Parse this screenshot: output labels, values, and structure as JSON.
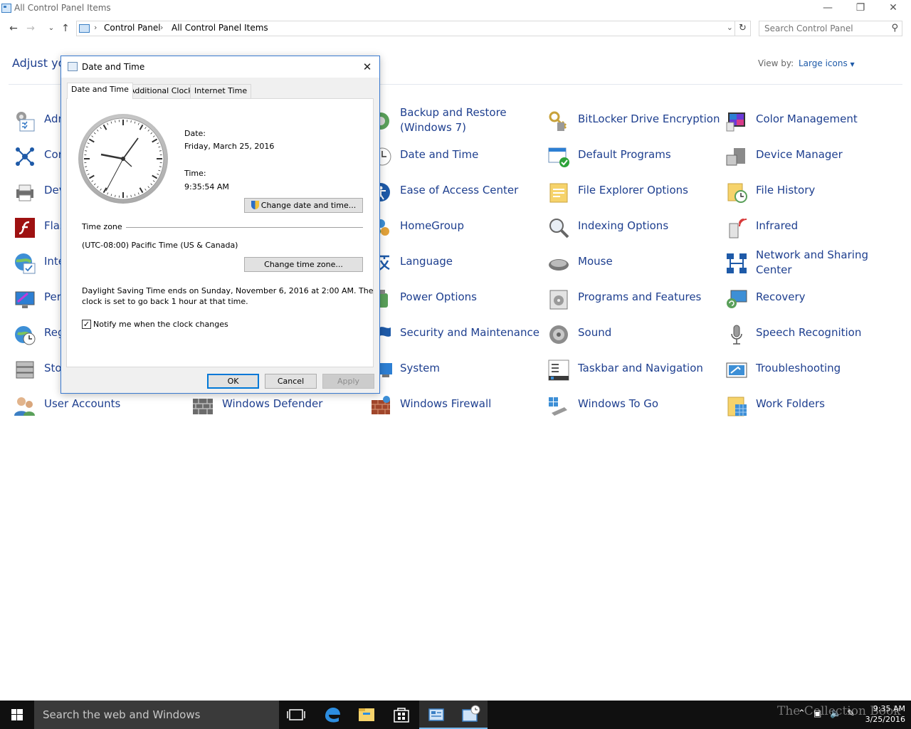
{
  "window": {
    "title": "All Control Panel Items",
    "breadcrumbs": [
      "Control Panel",
      "All Control Panel Items"
    ],
    "search_placeholder": "Search Control Panel",
    "heading": "Adjust you",
    "view_by_label": "View by:",
    "view_by_value": "Large icons"
  },
  "items": [
    {
      "label": "Adr"
    },
    {
      "label": "Cor"
    },
    {
      "label": "Dev"
    },
    {
      "label": "Flas"
    },
    {
      "label": "Inte"
    },
    {
      "label": "Per"
    },
    {
      "label": "Reg"
    },
    {
      "label": "Sto"
    },
    {
      "label": "User Accounts"
    },
    {
      "label": "Windows Defender"
    },
    {
      "label": "Backup and Restore (Windows 7)"
    },
    {
      "label": "Date and Time"
    },
    {
      "label": "Ease of Access Center"
    },
    {
      "label": "HomeGroup"
    },
    {
      "label": "Language"
    },
    {
      "label": "Power Options"
    },
    {
      "label": "Security and Maintenance"
    },
    {
      "label": "System"
    },
    {
      "label": "Windows Firewall"
    },
    {
      "label": "BitLocker Drive Encryption"
    },
    {
      "label": "Default Programs"
    },
    {
      "label": "File Explorer Options"
    },
    {
      "label": "Indexing Options"
    },
    {
      "label": "Mouse"
    },
    {
      "label": "Programs and Features"
    },
    {
      "label": "Sound"
    },
    {
      "label": "Taskbar and Navigation"
    },
    {
      "label": "Windows To Go"
    },
    {
      "label": "Color Management"
    },
    {
      "label": "Device Manager"
    },
    {
      "label": "File History"
    },
    {
      "label": "Infrared"
    },
    {
      "label": "Network and Sharing Center"
    },
    {
      "label": "Recovery"
    },
    {
      "label": "Speech Recognition"
    },
    {
      "label": "Troubleshooting"
    },
    {
      "label": "Work Folders"
    }
  ],
  "dialog": {
    "title": "Date and Time",
    "tabs": [
      "Date and Time",
      "Additional Clocks",
      "Internet Time"
    ],
    "date_label": "Date:",
    "date_value": "Friday, March 25, 2016",
    "time_label": "Time:",
    "time_value": "9:35:54 AM",
    "change_datetime_button": "Change date and time...",
    "timezone_group": "Time zone",
    "timezone_value": "(UTC-08:00) Pacific Time (US & Canada)",
    "change_timezone_button": "Change time zone...",
    "dst_line1": "Daylight Saving Time ends on Sunday, November 6, 2016 at 2:00 AM. The",
    "dst_line2": "clock is set to go back 1 hour at that time.",
    "notify_label": "Notify me when the clock changes",
    "notify_checked": true,
    "ok": "OK",
    "cancel": "Cancel",
    "apply": "Apply"
  },
  "taskbar": {
    "search_text": "Search the web and Windows",
    "time": "9:35 AM",
    "date": "3/25/2016",
    "watermark": "The Collection Book"
  },
  "colors": {
    "link": "#1e3f8f",
    "dialog_border": "#3a7ad0",
    "taskbar": "#101010",
    "active_indicator": "#76b9ed"
  }
}
